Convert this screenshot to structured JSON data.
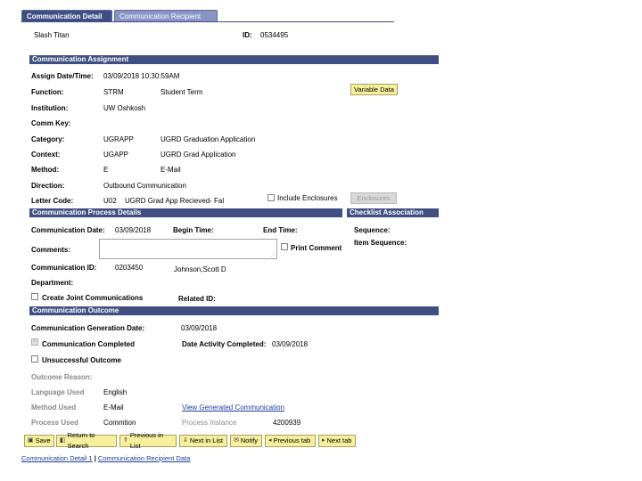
{
  "tabs": [
    {
      "label": "Communication Detail 1",
      "active": true
    },
    {
      "label": "Communication Recipient Data",
      "active": false
    }
  ],
  "header": {
    "name": "Slash Titan",
    "id_label": "ID:",
    "id_value": "0534495"
  },
  "assignment": {
    "section_title": "Communication Assignment",
    "assign_datetime_label": "Assign Date/Time:",
    "assign_datetime_value": "03/09/2018 10:30:59AM",
    "function_label": "Function:",
    "function_code": "STRM",
    "function_desc": "Student Term",
    "variable_data_button": "Variable Data",
    "institution_label": "Institution:",
    "institution_value": "UW Oshkosh",
    "comm_key_label": "Comm Key:",
    "category_label": "Category:",
    "category_code": "UGRAPP",
    "category_desc": "UGRD Graduation Application",
    "context_label": "Context:",
    "context_code": "UGAPP",
    "context_desc": "UGRD Grad Application",
    "method_label": "Method:",
    "method_code": "E",
    "method_desc": "E-Mail",
    "direction_label": "Direction:",
    "direction_value": "Outbound Communication",
    "letter_code_label": "Letter Code:",
    "letter_code_value": "U02",
    "letter_code_desc": "UGRD Grad App Recieved- Fal",
    "include_enclosures_label": "Include Enclosures",
    "enclosures_button": "Enclosures"
  },
  "process": {
    "section_title": "Communication Process Details",
    "comm_date_label": "Communication Date:",
    "comm_date_value": "03/09/2018",
    "begin_time_label": "Begin Time:",
    "end_time_label": "End Time:",
    "comments_label": "Comments:",
    "print_comment_label": "Print Comment",
    "comm_id_label": "Communication ID:",
    "comm_id_value": "0203450",
    "comm_id_name": "Johnson,Scott D",
    "department_label": "Department:",
    "create_joint_label": "Create Joint Communications",
    "related_id_label": "Related ID:"
  },
  "checklist": {
    "section_title": "Checklist Association",
    "sequence_label": "Sequence:",
    "item_sequence_label": "Item Sequence:"
  },
  "outcome": {
    "section_title": "Communication Outcome",
    "generation_date_label": "Communication Generation Date:",
    "generation_date_value": "03/09/2018",
    "completed_label": "Communication Completed",
    "date_activity_label": "Date Activity Completed:",
    "date_activity_value": "03/09/2018",
    "unsuccessful_label": "Unsuccessful Outcome",
    "outcome_reason_label": "Outcome Reason:",
    "language_label": "Language Used",
    "language_value": "English",
    "method_used_label": "Method Used",
    "method_used_value": "E-Mail",
    "view_generated_link": "View Generated Communication",
    "process_used_label": "Process Used",
    "process_used_value": "Commtion",
    "process_instance_label": "Process Instance",
    "process_instance_value": "4200939"
  },
  "toolbar": {
    "save": "Save",
    "return_to_search": "Return to Search",
    "previous_in_list": "Previous in List",
    "next_in_list": "Next in List",
    "notify": "Notify",
    "previous_tab": "Previous tab",
    "next_tab": "Next tab"
  },
  "bottom_links": {
    "link1": "Communication Detail 1",
    "separator": "|",
    "link2": "Communication Recipient Data"
  },
  "colors": {
    "section_bar": "#3f4f82",
    "button_yellow": "#f6ef9c",
    "link_blue": "#1f3a9e"
  }
}
